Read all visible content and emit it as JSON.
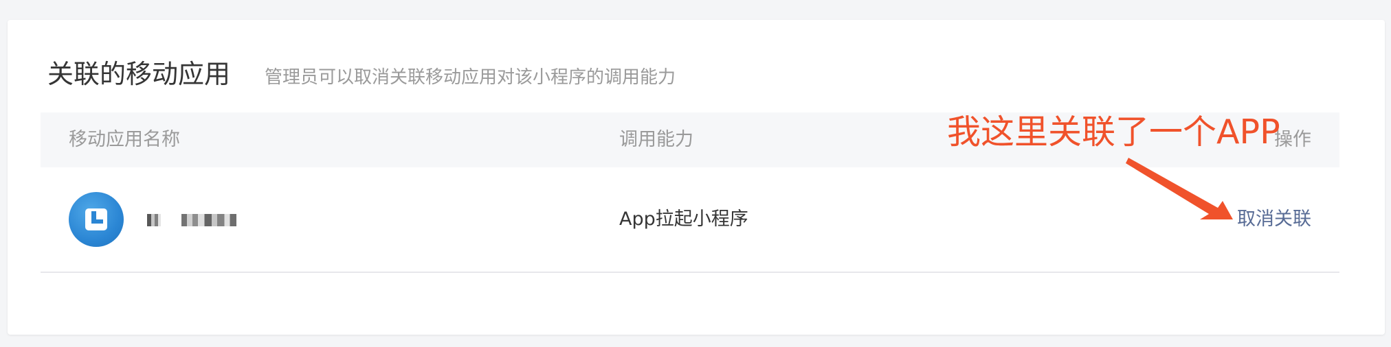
{
  "section": {
    "title": "关联的移动应用",
    "description": "管理员可以取消关联移动应用对该小程序的调用能力"
  },
  "table": {
    "headers": {
      "name": "移动应用名称",
      "capability": "调用能力",
      "action": "操作"
    },
    "rows": [
      {
        "app_name_visible": "",
        "capability": "App拉起小程序",
        "action_label": "取消关联"
      }
    ]
  },
  "annotation": {
    "text": "我这里关联了一个APP",
    "color": "#f0522b"
  },
  "colors": {
    "link": "#576b95",
    "app_icon": "#2b86d4"
  },
  "icons": {
    "app_icon": "mini-program-app-icon"
  }
}
